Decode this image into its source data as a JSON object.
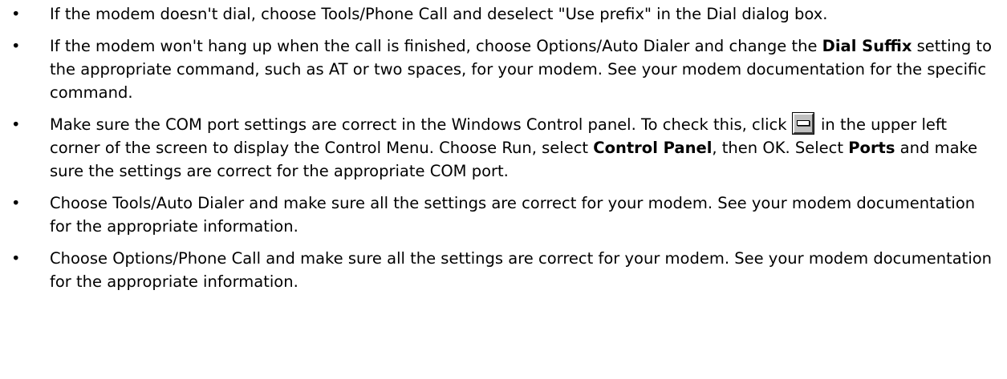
{
  "bullet_glyph": "•",
  "tips": [
    {
      "text1": "If the modem doesn't dial, choose Tools/Phone Call and deselect \"Use prefix\" in the Dial dialog box."
    },
    {
      "text1": "If the modem won't hang up when the call is finished, choose Options/Auto Dialer and change the ",
      "bold1": "Dial Suffix",
      "text2": " setting to the appropriate command, such as AT or two spaces, for your modem.   See your modem documentation for the specific command."
    },
    {
      "text1": "Make sure the COM port settings are correct in the Windows Control panel.   To check this, click ",
      "icon": "control-menu-icon",
      "text2": " in the upper left corner of the screen to display the Control Menu.   Choose Run, select ",
      "bold1": "Control Panel",
      "text3": ", then OK.   Select ",
      "bold2": "Ports",
      "text4": " and make sure the settings are correct for the appropriate COM port."
    },
    {
      "text1": "Choose Tools/Auto Dialer and make sure all the settings are correct for your modem.   See your modem documentation for the appropriate information."
    },
    {
      "text1": "Choose Options/Phone Call and make sure all the settings are correct for your modem.   See your modem documentation for the appropriate information."
    }
  ]
}
